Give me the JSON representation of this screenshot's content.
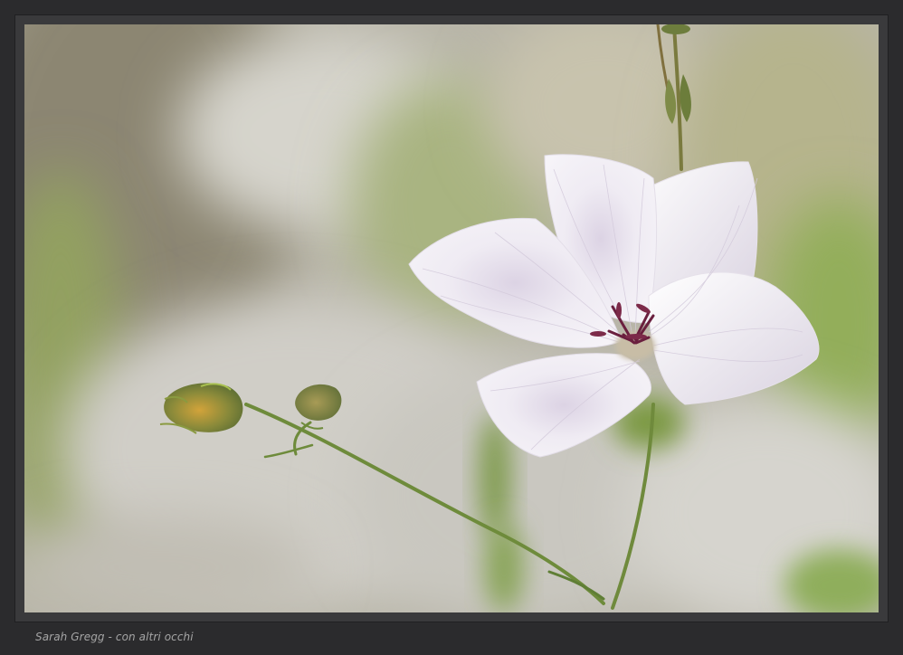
{
  "caption": "Sarah Gregg - con altri occhi",
  "colors": {
    "frame": "#2b2b2d",
    "petal": "#f1edf5",
    "stem": "#6f8a3c",
    "stamen": "#6a1f3e",
    "background_rock": "#cfcdc6",
    "foliage": "#7f9a48"
  },
  "subject": {
    "flower_count": 1,
    "bud_count": 2
  }
}
